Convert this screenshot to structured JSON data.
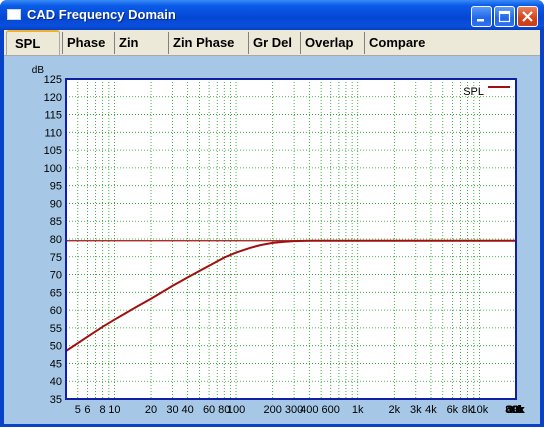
{
  "window": {
    "title": "CAD Frequency Domain",
    "buttons": [
      "minimize",
      "maximize",
      "close"
    ],
    "colors": {
      "titlebar": "#0a5ce8",
      "panel": "#a6c8e6",
      "plot_bg": "#ffffff",
      "plot_border": "#1020a0",
      "grid": "#1a9a1a",
      "series": "#a01010"
    }
  },
  "tabs": [
    {
      "label": "SPL",
      "active": true
    },
    {
      "label": "Phase",
      "active": false
    },
    {
      "label": "Zin",
      "active": false
    },
    {
      "label": "Zin Phase",
      "active": false
    },
    {
      "label": "Gr Del",
      "active": false
    },
    {
      "label": "Overlap",
      "active": false
    },
    {
      "label": "Compare",
      "active": false
    }
  ],
  "chart_data": {
    "type": "line",
    "title": "",
    "xlabel": "",
    "ylabel": "dB",
    "x_unit": "Hz",
    "xscale": "log",
    "xlim": [
      4,
      20000
    ],
    "ylim": [
      35,
      125
    ],
    "y_ticks": [
      125,
      120,
      115,
      110,
      105,
      100,
      95,
      90,
      85,
      80,
      75,
      70,
      65,
      60,
      55,
      50,
      45,
      40,
      35
    ],
    "x_ticks": [
      {
        "value": 5,
        "label": "5"
      },
      {
        "value": 6,
        "label": "6"
      },
      {
        "value": 8,
        "label": "8"
      },
      {
        "value": 10,
        "label": "10"
      },
      {
        "value": 20,
        "label": "20"
      },
      {
        "value": 30,
        "label": "30"
      },
      {
        "value": 40,
        "label": "40"
      },
      {
        "value": 60,
        "label": "60"
      },
      {
        "value": 80,
        "label": "80"
      },
      {
        "value": 100,
        "label": "100"
      },
      {
        "value": 200,
        "label": "200"
      },
      {
        "value": 300,
        "label": "300"
      },
      {
        "value": 400,
        "label": "400"
      },
      {
        "value": 600,
        "label": "600"
      },
      {
        "value": 1000,
        "label": "1k"
      },
      {
        "value": 2000,
        "label": "2k"
      },
      {
        "value": 3000,
        "label": "3k"
      },
      {
        "value": 4000,
        "label": "4k"
      },
      {
        "value": 6000,
        "label": "6k"
      },
      {
        "value": 8000,
        "label": "8k"
      },
      {
        "value": 10000,
        "label": "10k"
      },
      {
        "value": 20000,
        "label": "20k"
      },
      {
        "value": 30000,
        "label": "30k"
      },
      {
        "value": 40000,
        "label": "40k"
      },
      {
        "value": 60000,
        "label": "60k"
      },
      {
        "value": 80000,
        "label": "80k"
      }
    ],
    "x_end_label": "Hz",
    "grid": true,
    "legend": "top-right",
    "reference_line": 79.5,
    "series": [
      {
        "name": "SPL",
        "x": [
          4,
          6,
          8,
          10,
          15,
          20,
          30,
          40,
          50,
          60,
          80,
          100,
          130,
          160,
          200,
          250,
          300,
          400,
          500,
          700,
          1000,
          2000,
          5000,
          10000,
          20000
        ],
        "y": [
          48.5,
          52.5,
          55.3,
          57.3,
          60.8,
          63.2,
          66.8,
          69.2,
          71.0,
          72.5,
          74.8,
          76.2,
          77.5,
          78.3,
          78.9,
          79.2,
          79.4,
          79.5,
          79.5,
          79.5,
          79.5,
          79.5,
          79.5,
          79.5,
          79.5
        ]
      }
    ]
  }
}
